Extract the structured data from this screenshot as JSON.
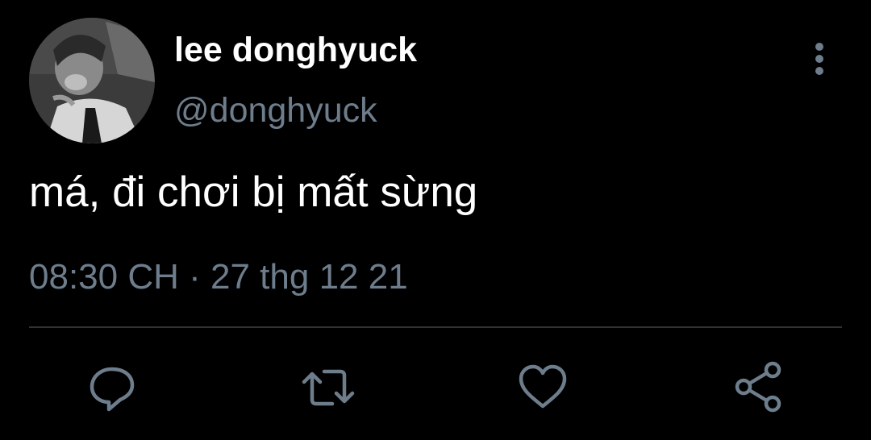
{
  "tweet": {
    "author": {
      "display_name": "lee donghyuck",
      "handle": "@donghyuck"
    },
    "text": "má, đi chơi bị mất sừng",
    "time": "08:30 CH",
    "separator": "·",
    "date": "27 thg 12 21"
  },
  "icons": {
    "more": "more-vertical-icon",
    "reply": "reply-icon",
    "retweet": "retweet-icon",
    "like": "heart-icon",
    "share": "share-icon"
  },
  "colors": {
    "background": "#000000",
    "primary_text": "#ffffff",
    "secondary_text": "#6e7d8c",
    "divider": "#2f3336"
  }
}
